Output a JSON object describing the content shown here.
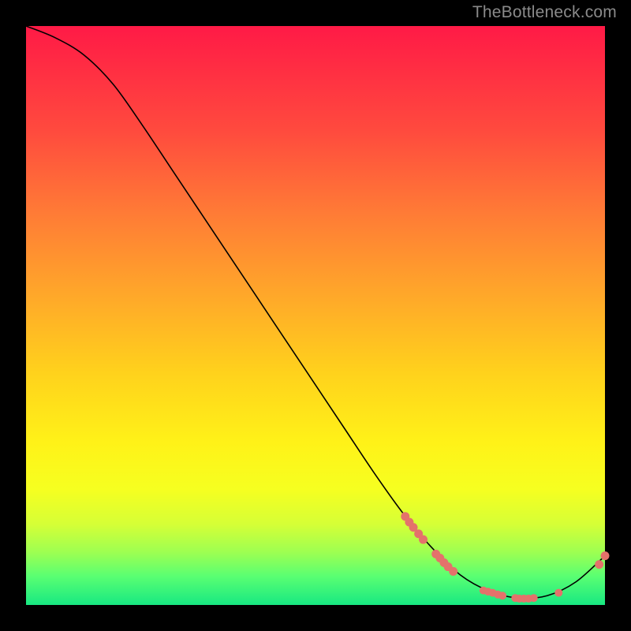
{
  "attribution": "TheBottleneck.com",
  "colors": {
    "background": "#000000",
    "curve": "#000000",
    "marker": "#e4726b",
    "gradient_top": "#ff1a46",
    "gradient_bottom": "#18e882"
  },
  "chart_data": {
    "type": "line",
    "title": "",
    "xlabel": "",
    "ylabel": "",
    "xlim": [
      0,
      100
    ],
    "ylim": [
      0,
      100
    ],
    "curve": [
      {
        "x": 0,
        "y": 100
      },
      {
        "x": 5,
        "y": 98
      },
      {
        "x": 10,
        "y": 95
      },
      {
        "x": 15,
        "y": 90
      },
      {
        "x": 20,
        "y": 83
      },
      {
        "x": 25,
        "y": 75.5
      },
      {
        "x": 30,
        "y": 68
      },
      {
        "x": 35,
        "y": 60.5
      },
      {
        "x": 40,
        "y": 53
      },
      {
        "x": 45,
        "y": 45.5
      },
      {
        "x": 50,
        "y": 38
      },
      {
        "x": 55,
        "y": 30.5
      },
      {
        "x": 60,
        "y": 23
      },
      {
        "x": 65,
        "y": 16
      },
      {
        "x": 70,
        "y": 10
      },
      {
        "x": 75,
        "y": 5.2
      },
      {
        "x": 80,
        "y": 2.4
      },
      {
        "x": 85,
        "y": 1.2
      },
      {
        "x": 90,
        "y": 1.6
      },
      {
        "x": 95,
        "y": 4.0
      },
      {
        "x": 100,
        "y": 8.5
      }
    ],
    "markers_upper_cluster": [
      {
        "x": 65.5,
        "y": 15.3
      },
      {
        "x": 66.2,
        "y": 14.3
      },
      {
        "x": 66.9,
        "y": 13.4
      },
      {
        "x": 67.8,
        "y": 12.3
      },
      {
        "x": 68.6,
        "y": 11.3
      },
      {
        "x": 70.8,
        "y": 8.8
      },
      {
        "x": 71.5,
        "y": 8.1
      },
      {
        "x": 72.2,
        "y": 7.3
      },
      {
        "x": 72.9,
        "y": 6.6
      },
      {
        "x": 73.8,
        "y": 5.8
      }
    ],
    "markers_trough_cluster": [
      {
        "x": 79.0,
        "y": 2.5
      },
      {
        "x": 79.8,
        "y": 2.3
      },
      {
        "x": 80.6,
        "y": 2.1
      },
      {
        "x": 81.5,
        "y": 1.8
      },
      {
        "x": 82.3,
        "y": 1.6
      },
      {
        "x": 84.5,
        "y": 1.2
      },
      {
        "x": 85.2,
        "y": 1.1
      },
      {
        "x": 86.0,
        "y": 1.1
      },
      {
        "x": 86.8,
        "y": 1.1
      },
      {
        "x": 87.7,
        "y": 1.2
      },
      {
        "x": 92.0,
        "y": 2.1
      }
    ],
    "markers_right_cluster": [
      {
        "x": 99.0,
        "y": 7.0
      },
      {
        "x": 100.0,
        "y": 8.5
      }
    ]
  }
}
